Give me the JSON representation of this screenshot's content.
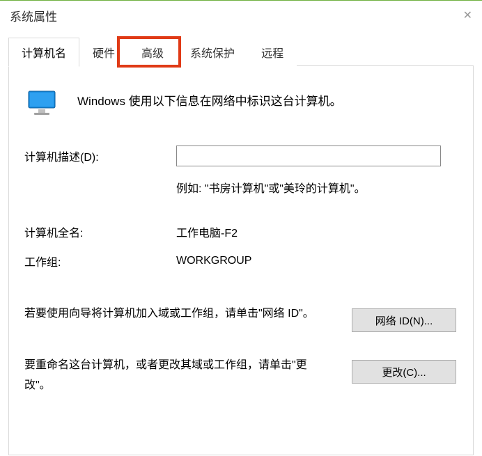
{
  "title": "系统属性",
  "tabs": {
    "computer_name": "计算机名",
    "hardware": "硬件",
    "advanced": "高级",
    "system_protection": "系统保护",
    "remote": "远程"
  },
  "intro": "Windows 使用以下信息在网络中标识这台计算机。",
  "fields": {
    "description_label": "计算机描述(D):",
    "description_value": "",
    "description_hint": "例如: \"书房计算机\"或\"美玲的计算机\"。",
    "fullname_label": "计算机全名:",
    "fullname_value": "工作电脑-F2",
    "workgroup_label": "工作组:",
    "workgroup_value": "WORKGROUP"
  },
  "sections": {
    "network_id_text": "若要使用向导将计算机加入域或工作组，请单击\"网络 ID\"。",
    "network_id_button": "网络 ID(N)...",
    "change_text": "要重命名这台计算机，或者更改其域或工作组，请单击\"更改\"。",
    "change_button": "更改(C)..."
  }
}
